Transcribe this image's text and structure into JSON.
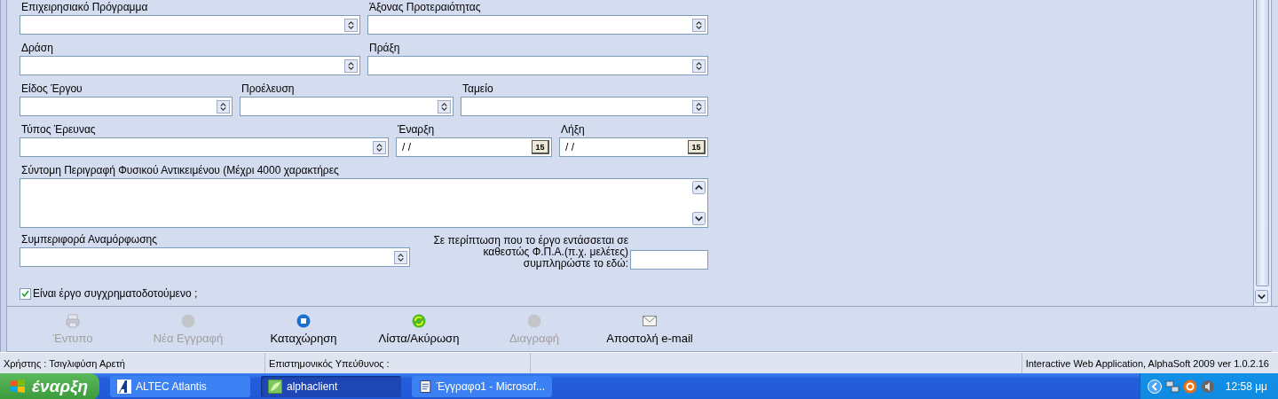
{
  "form": {
    "rows": [
      [
        {
          "kind": "select",
          "label": "Επιχειρησιακό Πρόγραμμα"
        },
        {
          "kind": "select",
          "label": "Άξονας Προτεραιότητας"
        }
      ],
      [
        {
          "kind": "select",
          "label": "Δράση"
        },
        {
          "kind": "select",
          "label": "Πράξη"
        }
      ],
      [
        {
          "kind": "select",
          "label": "Είδος Έργου"
        },
        {
          "kind": "select",
          "label": "Προέλευση"
        },
        {
          "kind": "select",
          "label": "Ταμείο"
        }
      ],
      [
        {
          "kind": "select",
          "label": "Τύπος Έρευνας"
        },
        {
          "kind": "date",
          "label": "Έναρξη",
          "value": "/ /",
          "calendar_day": "15"
        },
        {
          "kind": "date",
          "label": "Λήξη",
          "value": "/ /",
          "calendar_day": "15"
        }
      ],
      [
        {
          "kind": "textarea",
          "label": "Σύντομη Περιγραφή Φυσικού Αντικειμένου (Μέχρι 4000 χαρακτήρες"
        }
      ]
    ],
    "adjustment": {
      "label": "Συμπεριφορά Αναμόρφωσης"
    },
    "vat": {
      "lines": [
        "Σε περίπτωση που το έργο εντάσσεται σε",
        "καθεστώς Φ.Π.Α.(π.χ. μελέτες)",
        "συμπληρώστε το εδώ:"
      ]
    },
    "cofunded": {
      "label": "Είναι έργο συγχρηματοδοτούμενο ;",
      "checked": true
    }
  },
  "toolbar": [
    {
      "label": "Έντυπο",
      "disabled": true
    },
    {
      "label": "Νέα Εγγραφή",
      "disabled": true
    },
    {
      "label": "Καταχώρηση",
      "disabled": false
    },
    {
      "label": "Λίστα/Ακύρωση",
      "disabled": false
    },
    {
      "label": "Διαγραφή",
      "disabled": true
    },
    {
      "label": "Αποστολή e-mail",
      "disabled": false
    }
  ],
  "status_bar": [
    "Χρήστης : Τσιγλιφύση Αρετή",
    "Επιστημονικός Υπεύθυνος :",
    "Interactive Web Application, AlphaSoft 2009 ver 1.0.2.16"
  ],
  "taskbar": {
    "start": "έναρξη",
    "tasks": [
      {
        "label": "ALTEC Atlantis",
        "selected": false
      },
      {
        "label": "alphaclient",
        "selected": true
      },
      {
        "label": "Έγγραφο1 - Microsof...",
        "selected": false
      }
    ],
    "clock": "12:58 μμ"
  }
}
